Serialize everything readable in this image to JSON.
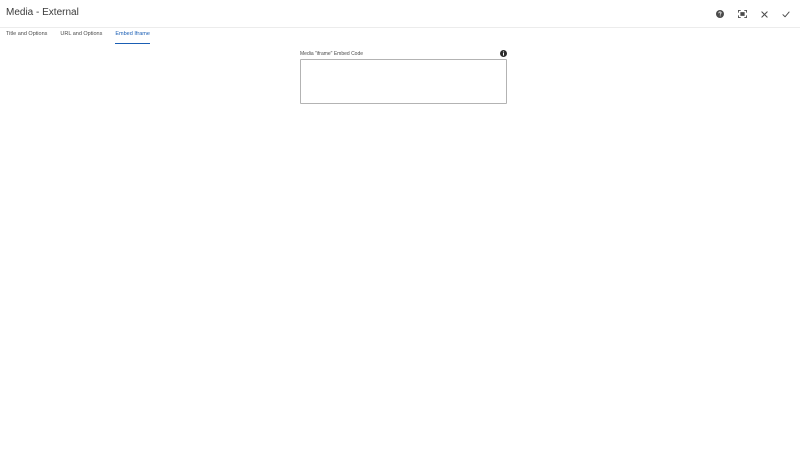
{
  "dialog": {
    "title": "Media - External"
  },
  "toolbar": {
    "help_icon": "help-circle-icon",
    "fullscreen_icon": "fullscreen-icon",
    "close_icon": "close-icon",
    "done_icon": "checkmark-icon"
  },
  "tabs": [
    {
      "label": "Title and Options",
      "active": false
    },
    {
      "label": "URL and Options",
      "active": false
    },
    {
      "label": "Embed Iframe",
      "active": true
    }
  ],
  "embed_field": {
    "label": "Media \"iframe\" Embed Code",
    "value": "",
    "info_icon": "info-icon"
  },
  "colors": {
    "accent": "#1a5eb4",
    "text": "#2c2c2c",
    "border": "#b3b3b3"
  }
}
